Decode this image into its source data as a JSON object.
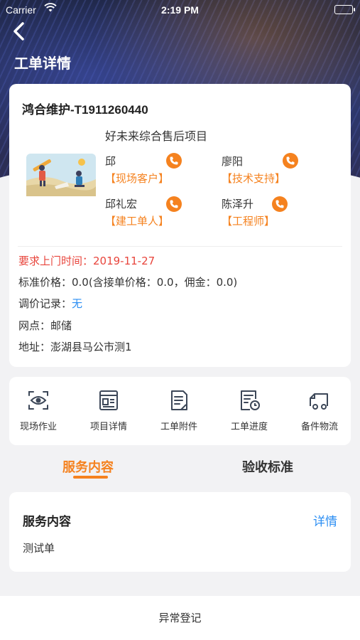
{
  "status_bar": {
    "carrier": "Carrier",
    "time": "2:19 PM"
  },
  "header": {
    "title": "工单详情"
  },
  "order": {
    "title": "鸿合维护-T1911260440",
    "project": "好未来综合售后项目",
    "contacts": [
      {
        "name": "邱",
        "role": "【现场客户】"
      },
      {
        "name": "廖阳",
        "role": "【技术支持】"
      },
      {
        "name": "邱礼宏",
        "role": "【建工单人】"
      },
      {
        "name": "陈泽升",
        "role": "【工程师】"
      }
    ],
    "visit_time": "要求上门时间：2019-11-27",
    "price": "标准价格：0.0(含接单价格：0.0，佣金：0.0)",
    "price_record_label": "调价记录：",
    "price_record_value": "无",
    "outlet": "网点：邮储",
    "address": "地址：澎湖县马公市测1"
  },
  "actions": [
    {
      "label": "现场作业",
      "icon": "eye-scan-icon"
    },
    {
      "label": "项目详情",
      "icon": "id-card-icon"
    },
    {
      "label": "工单附件",
      "icon": "document-icon"
    },
    {
      "label": "工单进度",
      "icon": "clock-document-icon"
    },
    {
      "label": "备件物流",
      "icon": "truck-icon"
    }
  ],
  "tabs": {
    "service": "服务内容",
    "acceptance": "验收标准"
  },
  "service_card": {
    "title": "服务内容",
    "detail": "详情",
    "content": "测试单"
  },
  "bottom": {
    "button": "异常登记"
  },
  "colors": {
    "accent": "#f5821f",
    "link": "#2b8ef3",
    "alert": "#e8453c"
  }
}
